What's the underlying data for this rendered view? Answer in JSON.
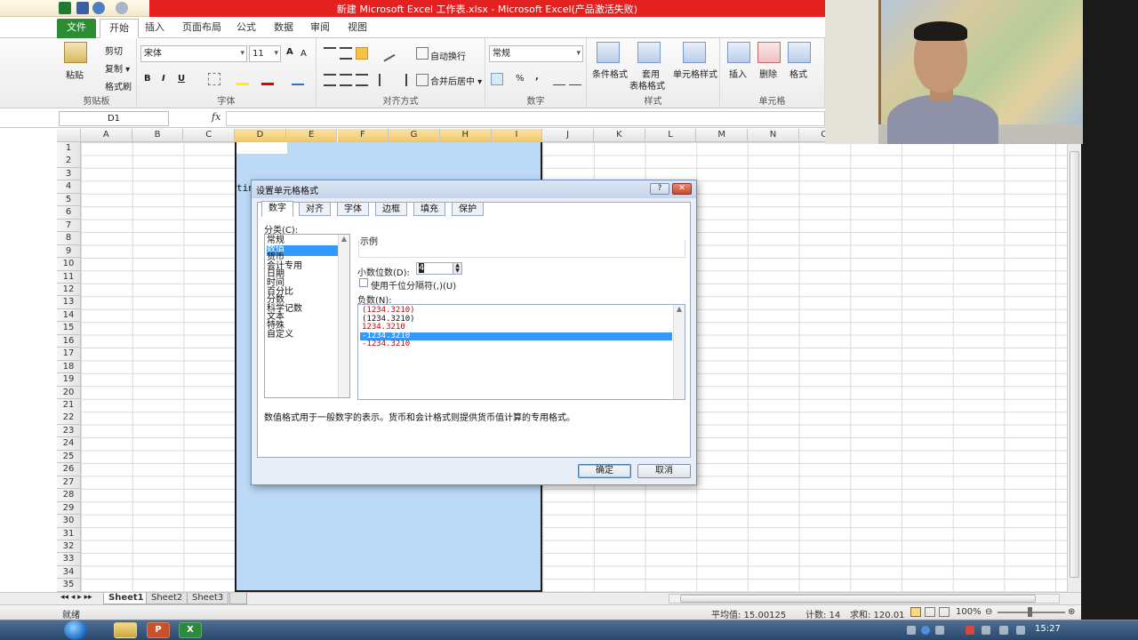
{
  "window": {
    "title": "新建 Microsoft Excel 工作表.xlsx - Microsoft Excel(产品激活失败)"
  },
  "ribbon_tabs": [
    {
      "label": "文件"
    },
    {
      "label": "开始"
    },
    {
      "label": "插入"
    },
    {
      "label": "页面布局"
    },
    {
      "label": "公式"
    },
    {
      "label": "数据"
    },
    {
      "label": "审阅"
    },
    {
      "label": "视图"
    }
  ],
  "clipboard": {
    "paste": "粘贴",
    "cut": "剪切",
    "copy": "复制 ▾",
    "painter": "格式刷",
    "label": "剪贴板"
  },
  "font": {
    "name": "宋体",
    "size": "11",
    "bold": "B",
    "italic": "I",
    "underline": "U",
    "label": "字体"
  },
  "alignment": {
    "wrap": "自动换行",
    "merge": "合并后居中 ▾",
    "label": "对齐方式"
  },
  "number": {
    "format": "常规",
    "percent": "%",
    "comma": ",",
    "label": "数字"
  },
  "styles": {
    "conditional": "条件格式",
    "table1": "套用",
    "table2": "表格格式",
    "cell": "单元格样式",
    "label": "样式"
  },
  "cells": {
    "insert": "插入",
    "delete": "删除",
    "format": "格式",
    "label": "单元格"
  },
  "formula_bar": {
    "name_box": "D1",
    "fx": "fx",
    "value": ""
  },
  "columns": [
    "A",
    "B",
    "C",
    "D",
    "E",
    "F",
    "G",
    "H",
    "I",
    "J",
    "K",
    "L",
    "M",
    "N",
    "O"
  ],
  "rows": [
    "1",
    "2",
    "3",
    "4",
    "5",
    "6",
    "7",
    "8",
    "9",
    "10",
    "11",
    "12",
    "13",
    "14",
    "15",
    "16",
    "17",
    "18",
    "19",
    "20",
    "21",
    "22",
    "23",
    "24",
    "25",
    "26",
    "27",
    "28",
    "29",
    "30",
    "31",
    "32",
    "33",
    "34",
    "35"
  ],
  "cell_overflow_text": "tin",
  "sheets": [
    {
      "label": "Sheet1"
    },
    {
      "label": "Sheet2"
    },
    {
      "label": "Sheet3"
    }
  ],
  "status": {
    "ready": "就绪",
    "average": "平均值: 15.00125",
    "count": "计数: 14",
    "sum": "求和: 120.01",
    "zoom": "100%"
  },
  "dialog": {
    "title": "设置单元格格式",
    "help": "?",
    "close": "✕",
    "tabs": [
      {
        "label": "数字"
      },
      {
        "label": "对齐"
      },
      {
        "label": "字体"
      },
      {
        "label": "边框"
      },
      {
        "label": "填充"
      },
      {
        "label": "保护"
      }
    ],
    "category_label": "分类(C):",
    "categories": [
      "常规",
      "数值",
      "货币",
      "会计专用",
      "日期",
      "时间",
      "百分比",
      "分数",
      "科学记数",
      "文本",
      "特殊",
      "自定义"
    ],
    "selected_category": 1,
    "sample_label": "示例",
    "decimal_label": "小数位数(D):",
    "decimal_value": "4",
    "thousands_label": "使用千位分隔符(,)(U)",
    "negative_label": "负数(N):",
    "negative_options": [
      {
        "text": "(1234.3210)",
        "color": "#cc0000"
      },
      {
        "text": "(1234.3210)",
        "color": "#111111"
      },
      {
        "text": "1234.3210",
        "color": "#cc0000"
      },
      {
        "text": "-1234.3210",
        "color": "#ffffff"
      },
      {
        "text": "-1234.3210",
        "color": "#cc0000"
      }
    ],
    "selected_negative": 3,
    "description": "数值格式用于一般数字的表示。货币和会计格式则提供货币值计算的专用格式。",
    "ok": "确定",
    "cancel": "取消"
  },
  "taskbar": {
    "clock": "15:27",
    "items": [
      {
        "label": "P"
      },
      {
        "label": "X"
      }
    ]
  }
}
